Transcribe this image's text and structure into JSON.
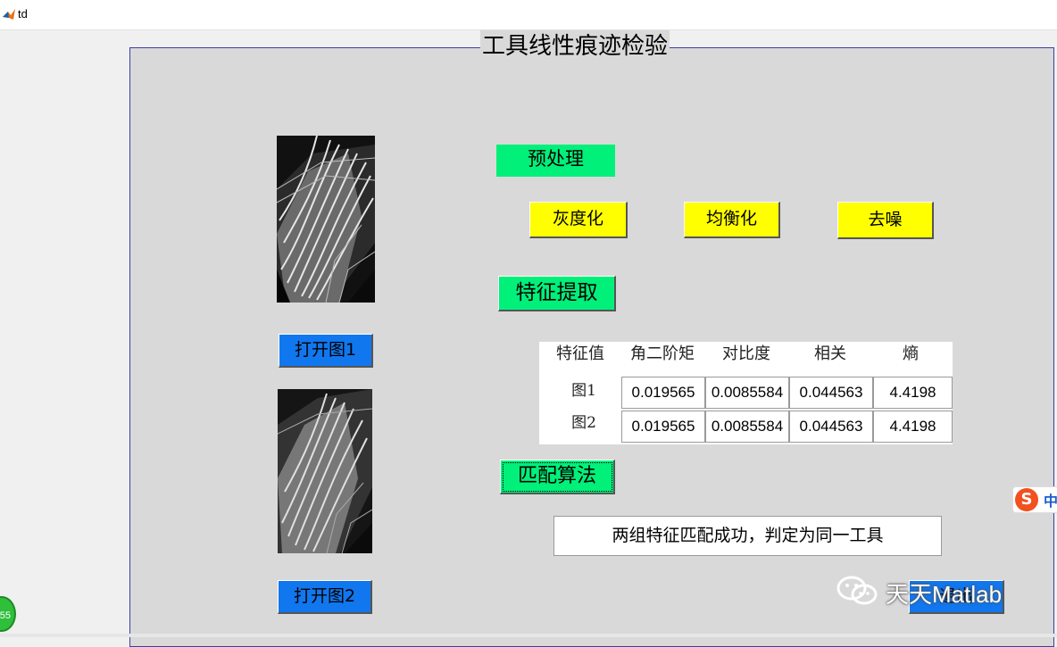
{
  "window": {
    "title": "td"
  },
  "panel": {
    "title": "工具线性痕迹检验"
  },
  "buttons": {
    "open_image1": "打开图1",
    "open_image2": "打开图2",
    "preprocess": "预处理",
    "grayscale": "灰度化",
    "equalize": "均衡化",
    "denoise": "去噪",
    "feature_extract": "特征提取",
    "match_algorithm": "匹配算法",
    "exit": "退出"
  },
  "feature_table": {
    "headers": [
      "特征值",
      "角二阶矩",
      "对比度",
      "相关",
      "熵"
    ],
    "rows": [
      {
        "label": "图1",
        "values": [
          "0.019565",
          "0.0085584",
          "0.044563",
          "4.4198"
        ]
      },
      {
        "label": "图2",
        "values": [
          "0.019565",
          "0.0085584",
          "0.044563",
          "4.4198"
        ]
      }
    ]
  },
  "result": {
    "text": "两组特征匹配成功，判定为同一工具"
  },
  "watermark": {
    "text": "天天Matlab"
  },
  "ime": {
    "label": "中"
  },
  "badge": {
    "text": "55"
  },
  "colors": {
    "blue_button": "#1177ee",
    "green_button": "#00f07a",
    "yellow_button": "#ffff00",
    "panel_bg": "#d9d9d9",
    "panel_border": "#3c3ca8"
  }
}
